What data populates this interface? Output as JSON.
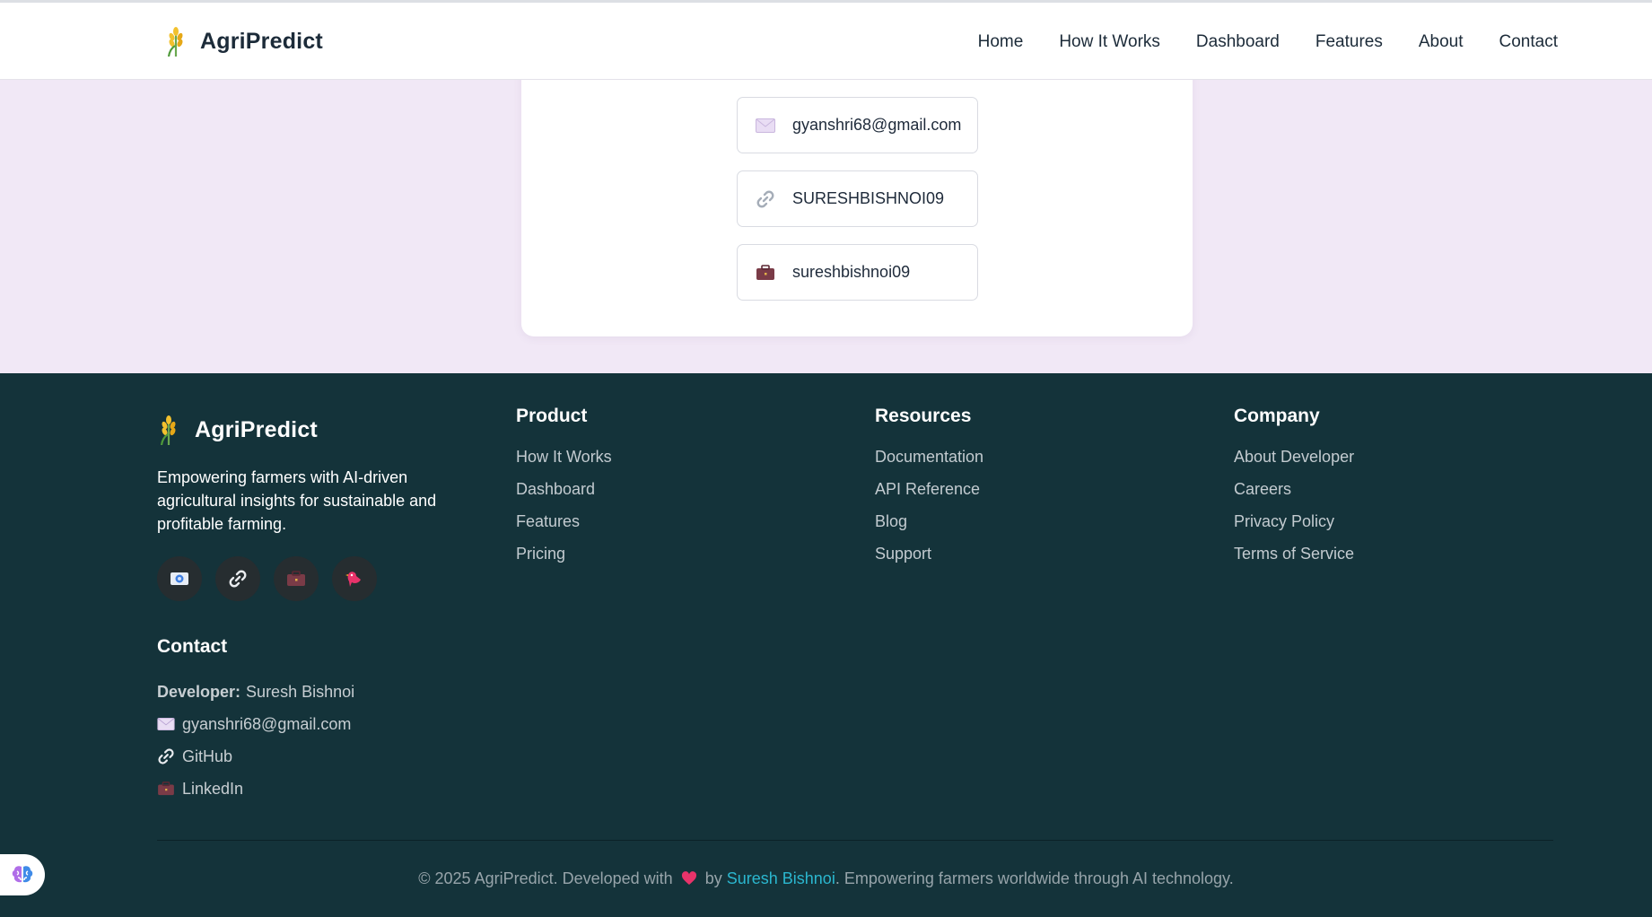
{
  "header": {
    "brand": "AgriPredict",
    "nav": [
      "Home",
      "How It Works",
      "Dashboard",
      "Features",
      "About",
      "Contact"
    ]
  },
  "card": {
    "email": "gyanshri68@gmail.com",
    "github": "SURESHBISHNOI09",
    "linkedin": "sureshbishnoi09"
  },
  "footer": {
    "brand": "AgriPredict",
    "tagline": "Empowering farmers with AI-driven agricultural insights for sustainable and profitable farming.",
    "contact": {
      "heading": "Contact",
      "developer_label": "Developer:",
      "developer_name": "Suresh Bishnoi",
      "email": "gyanshri68@gmail.com",
      "github": "GitHub",
      "linkedin": "LinkedIn"
    },
    "columns": [
      {
        "heading": "Product",
        "links": [
          "How It Works",
          "Dashboard",
          "Features",
          "Pricing"
        ]
      },
      {
        "heading": "Resources",
        "links": [
          "Documentation",
          "API Reference",
          "Blog",
          "Support"
        ]
      },
      {
        "heading": "Company",
        "links": [
          "About Developer",
          "Careers",
          "Privacy Policy",
          "Terms of Service"
        ]
      }
    ],
    "copyright": {
      "prefix": "© 2025 AgriPredict. Developed with",
      "by": "by",
      "developer": "Suresh Bishnoi",
      "suffix": ". Empowering farmers worldwide through AI technology."
    }
  },
  "icons": {
    "brand_logo": "wheat-icon",
    "email": "envelope-icon",
    "github": "link-icon",
    "linkedin": "briefcase-icon",
    "social_1": "photo-icon",
    "social_4": "bird-icon",
    "heart": "heart-icon",
    "fab": "brain-icon"
  },
  "colors": {
    "footer_bg": "#14333a",
    "page_bg": "#f1e8f6",
    "accent_link": "#2bb7cf",
    "heart": "#e8336a"
  }
}
